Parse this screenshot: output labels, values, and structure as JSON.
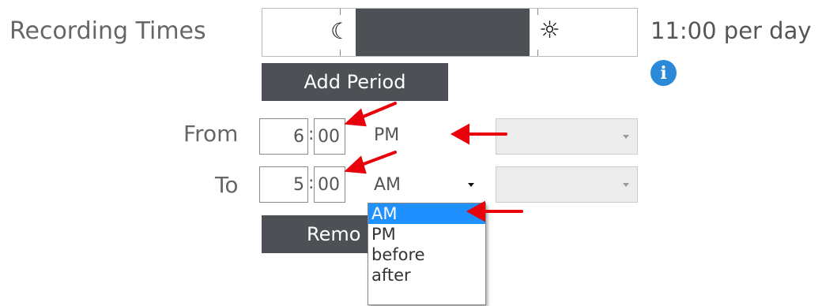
{
  "recording": {
    "label": "Recording Times",
    "summary": "11:00 per day",
    "moon_icon": "☾",
    "sun_icon": "☼"
  },
  "buttons": {
    "add_period": "Add Period",
    "remove": "Remo"
  },
  "from_row": {
    "label": "From",
    "hour": "6",
    "colon": ":",
    "minute": "00",
    "period": "PM"
  },
  "to_row": {
    "label": "To",
    "hour": "5",
    "colon": ":",
    "minute": "00",
    "period": "AM"
  },
  "dropdown": {
    "options": [
      "AM",
      "PM",
      "before",
      "after"
    ],
    "selected": "AM"
  },
  "colors": {
    "night": "#4d5055",
    "selected_option": "#1e90ff",
    "info": "#2a8ad8",
    "annotation_arrow": "#e8000b"
  }
}
